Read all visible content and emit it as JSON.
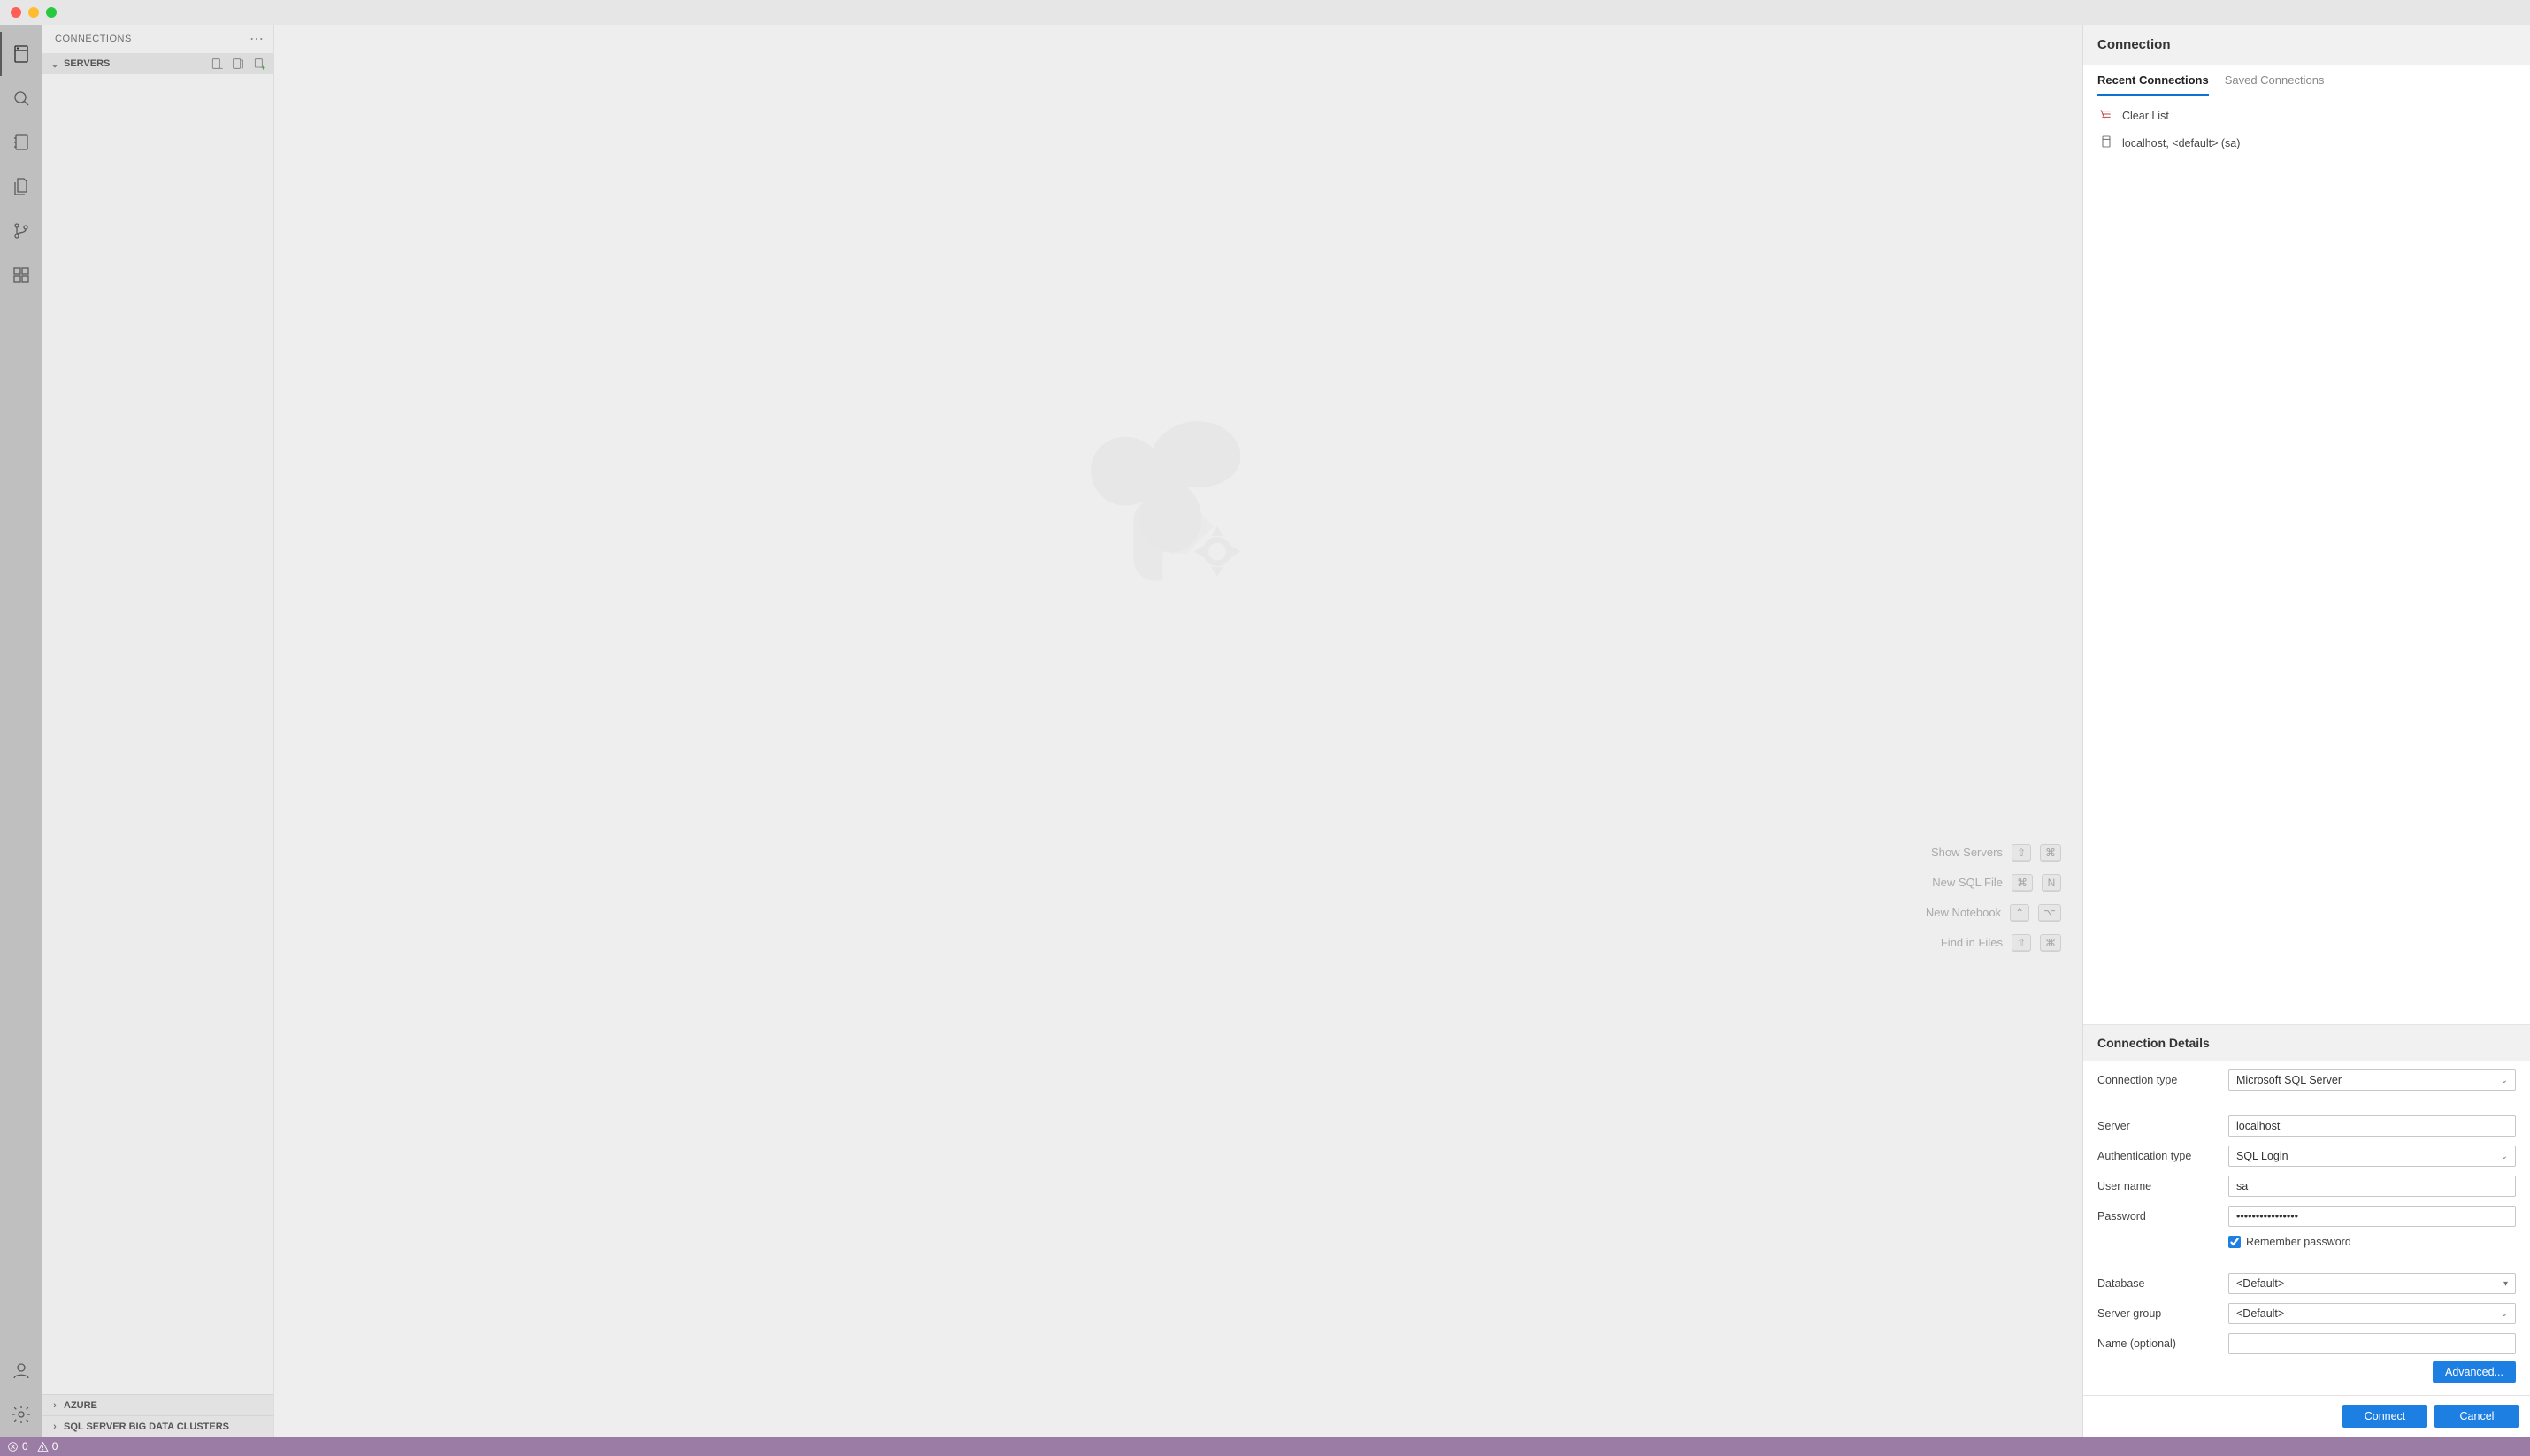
{
  "sidebar": {
    "title": "CONNECTIONS",
    "sections": {
      "servers": "SERVERS",
      "azure": "AZURE",
      "bdc": "SQL SERVER BIG DATA CLUSTERS"
    }
  },
  "quick": {
    "showServers": "Show Servers",
    "newSql": "New SQL File",
    "newNotebook": "New Notebook",
    "findInFiles": "Find in Files",
    "keys": {
      "shift": "⇧",
      "cmd": "⌘",
      "ctrl": "⌃",
      "opt": "⌥",
      "N": "N"
    }
  },
  "conn": {
    "title": "Connection",
    "tabs": {
      "recent": "Recent Connections",
      "saved": "Saved Connections"
    },
    "clear": "Clear List",
    "recentItem": "localhost, <default> (sa)",
    "detailsTitle": "Connection Details",
    "labels": {
      "connectionType": "Connection type",
      "server": "Server",
      "authType": "Authentication type",
      "user": "User name",
      "password": "Password",
      "remember": " Remember password",
      "database": "Database",
      "serverGroup": "Server group",
      "nameOpt": "Name (optional)"
    },
    "values": {
      "connectionType": "Microsoft SQL Server",
      "server": "localhost",
      "authType": "SQL Login",
      "user": "sa",
      "password": "••••••••••••••••",
      "database": "<Default>",
      "serverGroup": "<Default>",
      "nameOpt": ""
    },
    "buttons": {
      "advanced": "Advanced...",
      "connect": "Connect",
      "cancel": "Cancel"
    }
  },
  "status": {
    "errors": "0",
    "warnings": "0"
  }
}
